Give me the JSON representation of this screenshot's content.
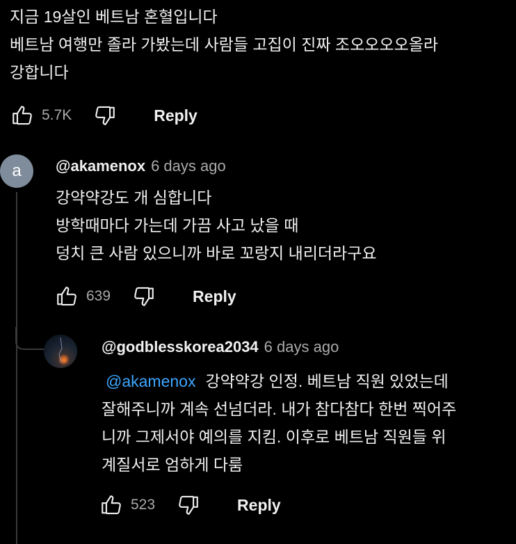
{
  "top_comment": {
    "lines": [
      "지금 19살인 베트남 혼혈입니다",
      "베트남 여행만 졸라 가봤는데 사람들 고집이 진짜 조오오오오올라",
      "강합니다"
    ],
    "likes": "5.7K",
    "reply_label": "Reply"
  },
  "reply1": {
    "avatar_letter": "a",
    "author": "@akamenox",
    "time": "6 days ago",
    "lines": [
      "강약약강도 개 심합니다",
      "방학때마다 가는데 가끔 사고 났을 때",
      "덩치 큰 사람 있으니까 바로 꼬랑지 내리더라구요"
    ],
    "likes": "639",
    "reply_label": "Reply"
  },
  "reply2": {
    "author": "@godblesskorea2034",
    "time": "6 days ago",
    "mention": "@akamenox",
    "lines": [
      "강약약강 인정. 베트남 직원 있었는데",
      "잘해주니까 계속 선넘더라. 내가 참다참다 한번 찍어주",
      "니까 그제서야 예의를 지킴. 이후로 베트남 직원들 위",
      "계질서로 엄하게 다룸"
    ],
    "likes": "523",
    "reply_label": "Reply"
  },
  "colors": {
    "background": "#000000",
    "text": "#f1f1f1",
    "secondary": "#aaaaaa",
    "mention": "#3ea6ff",
    "avatar": "#7f8c9b"
  },
  "icons": [
    "thumbs-up-icon",
    "thumbs-down-icon"
  ]
}
